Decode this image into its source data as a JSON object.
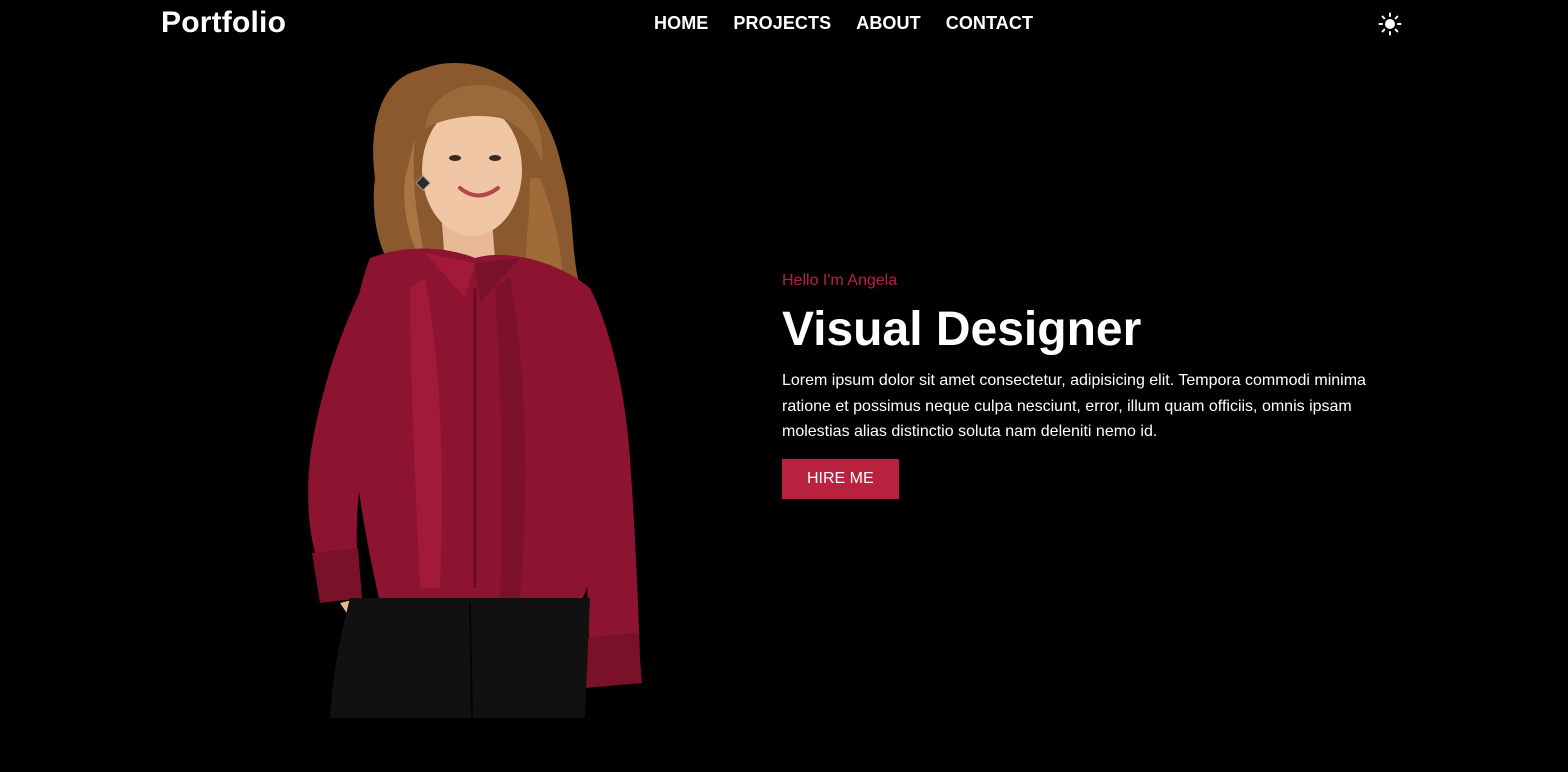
{
  "header": {
    "logo": "Portfolio",
    "nav": [
      "HOME",
      "PROJECTS",
      "ABOUT",
      "CONTACT"
    ],
    "theme_icon": "sun-icon"
  },
  "hero": {
    "greeting": "Hello I'm Angela",
    "title": "Visual Designer",
    "description": "Lorem ipsum dolor sit amet consectetur, adipisicing elit. Tempora commodi minima ratione et possimus neque culpa nesciunt, error, illum quam officiis, omnis ipsam molestias alias distinctio soluta nam deleniti nemo id.",
    "button": "HIRE ME",
    "image": "portrait-photo"
  },
  "colors": {
    "background": "#000000",
    "accent": "#b8223f",
    "text": "#ffffff"
  }
}
